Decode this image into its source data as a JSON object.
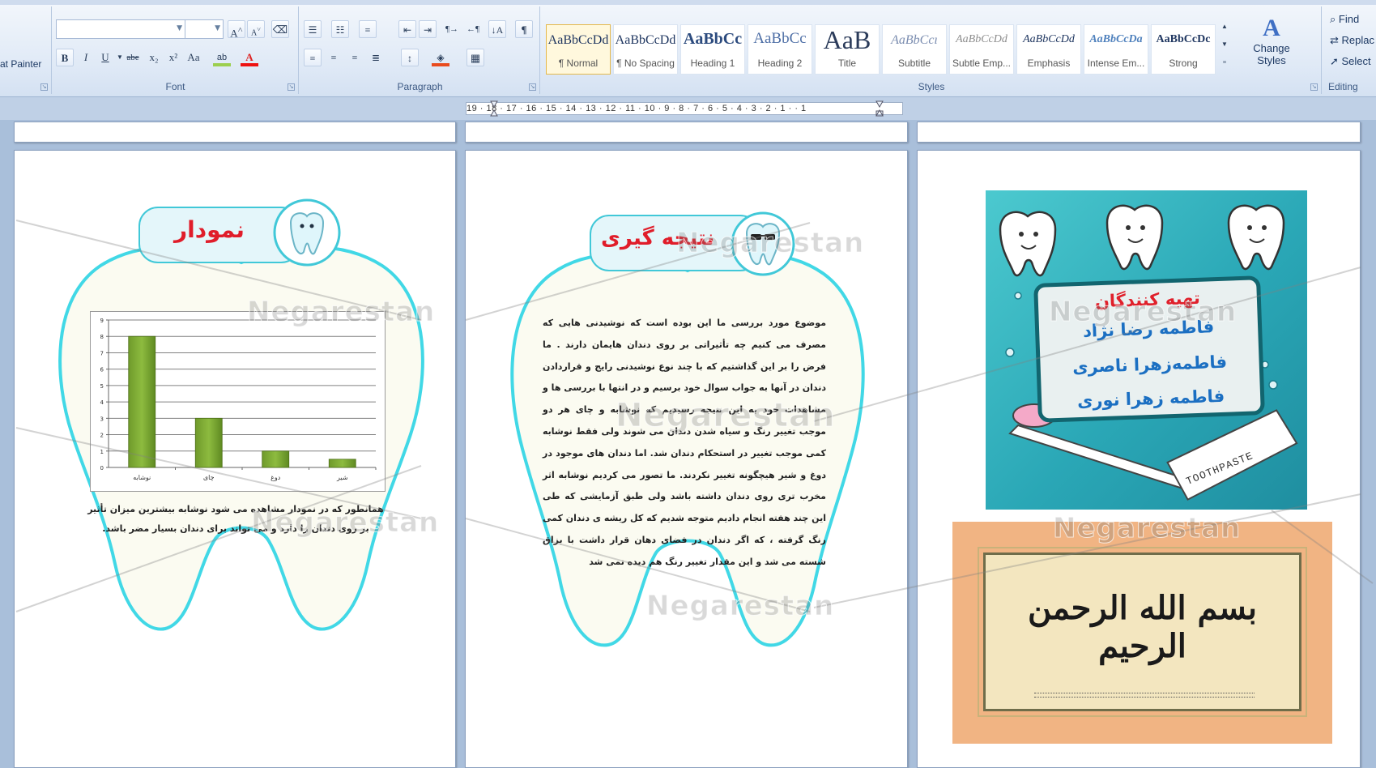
{
  "ribbon": {
    "clipboard": {
      "format_painter_label": "at Painter"
    },
    "font": {
      "group_label": "Font",
      "font_name": "",
      "font_size": "",
      "grow_label": "A",
      "shrink_label": "A",
      "bold": "B",
      "italic": "I",
      "underline": "U",
      "strikethrough": "abe",
      "subscript": "x₂",
      "superscript": "x²",
      "change_case": "Aa",
      "font_color": "A"
    },
    "paragraph": {
      "group_label": "Paragraph",
      "pilcrow": "¶"
    },
    "styles": {
      "group_label": "Styles",
      "items": [
        {
          "sample": "AaBbCcDd",
          "name": "¶ Normal"
        },
        {
          "sample": "AaBbCcDd",
          "name": "¶ No Spacing"
        },
        {
          "sample": "AaBbCс",
          "name": "Heading 1"
        },
        {
          "sample": "AaBbCc",
          "name": "Heading 2"
        },
        {
          "sample": "AaB",
          "name": "Title"
        },
        {
          "sample": "AaBbCcı",
          "name": "Subtitle"
        },
        {
          "sample": "AaBbCcDd",
          "name": "Subtle Emp..."
        },
        {
          "sample": "AaBbCcDd",
          "name": "Emphasis"
        },
        {
          "sample": "AaBbCcDa",
          "name": "Intense Em..."
        },
        {
          "sample": "AaBbCcDc",
          "name": "Strong"
        }
      ],
      "change_styles_line1": "Change",
      "change_styles_line2": "Styles"
    },
    "editing": {
      "group_label": "Editing",
      "find": "Find",
      "replace": "Replac",
      "select": "Select"
    }
  },
  "ruler": {
    "text": "19 · 18 · 17 · 16 · 15 · 14 · 13 · 12 · 11 · 10 · 9 · 8 · 7 · 6 · 5 · 4 · 3 · 2 · 1 · · 1"
  },
  "page_chart": {
    "title": "نمودار",
    "caption": "همانطور که در نمودار مشاهده می شود نوشابه بیشترین میزان تأثیر بر روی دندان را دارد و می تواند برای دندان بسیار مضر باشد."
  },
  "chart_data": {
    "type": "bar",
    "categories": [
      "نوشابه",
      "چای",
      "دوغ",
      "شیر"
    ],
    "values": [
      8,
      3,
      1,
      0.5
    ],
    "ylim": [
      0,
      9
    ],
    "yticks": [
      "0",
      "1",
      "2",
      "3",
      "4",
      "5",
      "6",
      "7",
      "8",
      "9"
    ],
    "grid": true,
    "legend": "none",
    "color": "#8dbb3f"
  },
  "page_conclusion": {
    "title": "نتیجه گیری",
    "body": "موضوع مورد بررسی ما این بوده است که نوشیدنی هایی که مصرف می کنیم چه تأثیراتی بر روی دندان هایمان دارند . ما فرض را بر این گذاشتیم که با چند نوع نوشیدنی رایج و قراردادن دندان در آنها به جواب سوال خود برسیم و در انتها با بررسی ها و مشاهدات خود به این نتیجه رسیدیم که نوشابه و چای هر دو موجب تغییر رنگ و سیاه شدن دندان می شوند ولی فقط نوشابه کمی موجب تغییر در استحکام دندان شد. اما دندان های موجود در دوغ و شیر هیچگونه تغییر نکردند. ما تصور می کردیم نوشابه اثر مخرب تری روی دندان داشته باشد ولی طبق آزمایشی که طی این چند هفته انجام دادیم متوجه شدیم که کل ریشه ی دندان کمی رنگ گرفته ، که اگر دندان در فضای دهان قرار داشت با بزاق شسته می شد و این مقدار تغییر رنگ هم دیده نمی شد"
  },
  "page_cover": {
    "heading": "تهیه کنندگان",
    "names": [
      "فاطمه رضا نژاد",
      "فاطمه‌زهرا ناصری",
      "فاطمه زهرا نوری"
    ],
    "toothpaste_label": "TOOTHPASTE",
    "calligraphy": "بسم الله الرحمن الرحیم"
  },
  "watermark": {
    "text": "Negarestan"
  },
  "colors": {
    "title_red": "#e01d2a",
    "tooth_outline": "#41d8e6",
    "cover_teal": "#2aa7b6",
    "name_blue": "#1b6fc2",
    "bar_green": "#8dbb3f"
  }
}
